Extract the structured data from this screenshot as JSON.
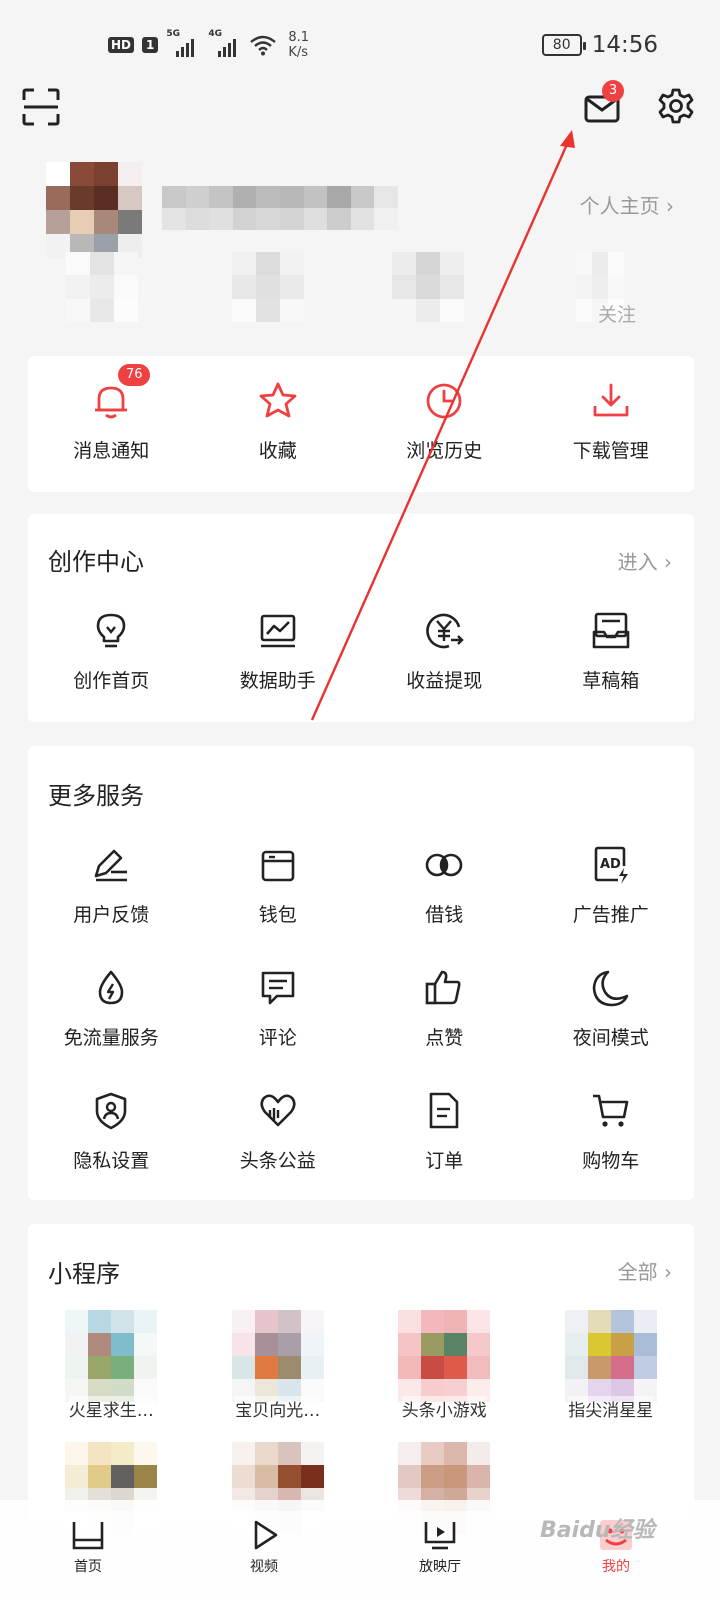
{
  "status_bar": {
    "hd": "HD",
    "sim": "1",
    "net1": "5G",
    "net2": "4G",
    "speed_value": "8.1",
    "speed_unit": "K/s",
    "battery": "80",
    "time": "14:56"
  },
  "topbar": {
    "mail_badge": "3"
  },
  "profile": {
    "homepage_link": "个人主页 ›",
    "follow_label": "关注"
  },
  "quick_actions": [
    {
      "label": "消息通知",
      "icon": "bell-icon",
      "badge": "76"
    },
    {
      "label": "收藏",
      "icon": "star-icon"
    },
    {
      "label": "浏览历史",
      "icon": "clock-icon"
    },
    {
      "label": "下载管理",
      "icon": "download-icon"
    }
  ],
  "creation_center": {
    "title": "创作中心",
    "more": "进入 ›",
    "items": [
      {
        "label": "创作首页",
        "icon": "lightbulb-icon"
      },
      {
        "label": "数据助手",
        "icon": "chart-icon"
      },
      {
        "label": "收益提现",
        "icon": "yuan-icon"
      },
      {
        "label": "草稿箱",
        "icon": "drafts-icon"
      }
    ]
  },
  "more_services": {
    "title": "更多服务",
    "items": [
      {
        "label": "用户反馈",
        "icon": "pen-icon"
      },
      {
        "label": "钱包",
        "icon": "wallet-icon"
      },
      {
        "label": "借钱",
        "icon": "loan-icon"
      },
      {
        "label": "广告推广",
        "icon": "ad-icon"
      },
      {
        "label": "免流量服务",
        "icon": "data-drop-icon"
      },
      {
        "label": "评论",
        "icon": "comment-icon"
      },
      {
        "label": "点赞",
        "icon": "thumbs-up-icon"
      },
      {
        "label": "夜间模式",
        "icon": "moon-icon"
      },
      {
        "label": "隐私设置",
        "icon": "privacy-shield-icon"
      },
      {
        "label": "头条公益",
        "icon": "charity-icon"
      },
      {
        "label": "订单",
        "icon": "order-icon"
      },
      {
        "label": "购物车",
        "icon": "cart-icon"
      }
    ]
  },
  "mini_programs": {
    "title": "小程序",
    "more": "全部 ›",
    "items": [
      {
        "name": "火星求生…"
      },
      {
        "name": "宝贝向光…"
      },
      {
        "name": "头条小游戏"
      },
      {
        "name": "指尖消星星"
      },
      {
        "name": ""
      },
      {
        "name": ""
      },
      {
        "name": ""
      }
    ]
  },
  "bottom_nav": [
    {
      "label": "首页",
      "icon": "home-icon"
    },
    {
      "label": "视频",
      "icon": "video-icon"
    },
    {
      "label": "放映厅",
      "icon": "cinema-icon"
    },
    {
      "label": "我的",
      "icon": "me-icon"
    }
  ],
  "watermark": "Baidu经验",
  "colors": {
    "accent": "#f04142",
    "background": "#f5f5f5",
    "card": "#ffffff",
    "annotation_arrow": "#e8332e"
  }
}
